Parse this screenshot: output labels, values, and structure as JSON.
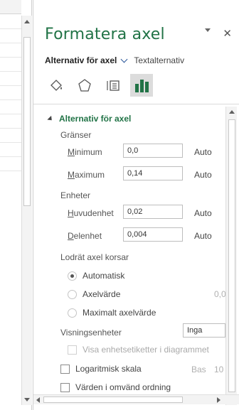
{
  "pane": {
    "title": "Formatera axel",
    "tabs": [
      "Alternativ för axel",
      "Textalternativ"
    ],
    "icons": [
      "fill-line-icon",
      "effects-icon",
      "size-properties-icon",
      "axis-options-icon"
    ]
  },
  "section": {
    "title": "Alternativ för axel",
    "bounds_label": "Gränser",
    "minimum_label_prefix": "M",
    "minimum_label_rest": "inimum",
    "minimum_value": "0,0",
    "maximum_label_prefix": "M",
    "maximum_label_rest": "aximum",
    "maximum_value": "0,14",
    "auto_label": "Auto",
    "units_label": "Enheter",
    "major_label_prefix": "H",
    "major_label_rest": "uvudenhet",
    "major_value": "0,02",
    "minor_label_prefix": "D",
    "minor_label_rest": "elenhet",
    "minor_value": "0,004",
    "crosses_label": "Lodrät axel korsar",
    "radio_auto": "Automatisk",
    "radio_value": "Axelvärde",
    "radio_value_field": "0,0",
    "radio_max": "Maximalt axelvärde",
    "display_units_label": "Visningsenheter",
    "display_units_value": "Inga",
    "show_units_label": "Visa enhetsetiketter i diagrammet",
    "log_scale_label": "Logaritmisk skala",
    "base_label": "Bas",
    "base_value": "10",
    "reverse_label": "Värden i omvänd ordning"
  },
  "colors": {
    "accent_green": "#217346",
    "active_icon_bg": "#dcdcdc"
  }
}
